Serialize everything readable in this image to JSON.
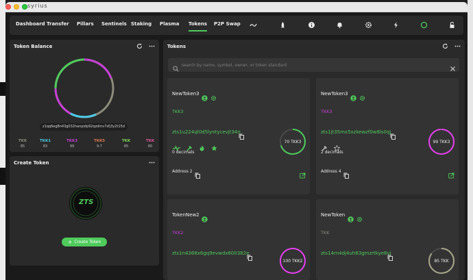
{
  "window": {
    "title": "syrius"
  },
  "nav": {
    "items": [
      {
        "label": "Dashboard"
      },
      {
        "label": "Transfer"
      },
      {
        "label": "Pillars"
      },
      {
        "label": "Sentinels"
      },
      {
        "label": "Staking"
      },
      {
        "label": "Plasma"
      },
      {
        "label": "Tokens",
        "active": true
      },
      {
        "label": "P2P Swap"
      }
    ],
    "icons": [
      "bridge-icon",
      "rocket-icon",
      "info-icon",
      "bell-icon",
      "settings-icon",
      "bolt-icon",
      "status-circle-icon",
      "lock-icon"
    ]
  },
  "token_balance": {
    "title": "Token Balance",
    "address": "z1qq6eg8n43g032hanpsfp92qzdmv7zfj3y2t15d",
    "tokens": [
      {
        "symbol": "TKK",
        "value": "85",
        "color": "#8c8c7c"
      },
      {
        "symbol": "TKK1",
        "value": "83",
        "color": "#4cc9e8"
      },
      {
        "symbol": "TKK3",
        "value": "99",
        "color": "#c63fd6"
      },
      {
        "symbol": "TKK5",
        "value": "9.7",
        "color": "#e07a4f"
      },
      {
        "symbol": "TKK",
        "value": "85",
        "color": "#7ed957"
      },
      {
        "symbol": "TKK",
        "value": "80",
        "color": "#e0529c"
      }
    ],
    "ring_colors": [
      "#4fcb5c",
      "#c63fd6",
      "#4cc9e8",
      "#8c8c7c"
    ]
  },
  "create_token": {
    "title": "Create Token",
    "logo_text": "ZTS",
    "button_label": "Create Token"
  },
  "tokens_panel": {
    "title": "Tokens",
    "search_placeholder": "search by name, symbol, owner, or token standard",
    "cards": [
      {
        "name": "NewToken3",
        "symbol": "TKK3",
        "symbol_color": "#4fcb5c",
        "address": "zts1u224ql0d5lyntycevjt34n",
        "decimals": "0 decimals",
        "address_label": "Address 2",
        "ring_value": "70 TKK3",
        "ring_color": "#4fcb5c",
        "ring_fraction": 0.7
      },
      {
        "name": "NewToken3",
        "symbol": "TKK3",
        "symbol_color": "#c63fd6",
        "address": "zts1jt35mx5xzkewzf0w8ls0qj",
        "decimals": "2 decimals",
        "address_label": "Address 4",
        "ring_value": "99 TKK3",
        "ring_color": "#e63ff0",
        "ring_fraction": 0.99
      },
      {
        "name": "TokenNew2",
        "symbol": "TKK2",
        "symbol_color": "#c63fd6",
        "address": "zts1n4368x6gq9evwdx600382e",
        "ring_value": "100 TKK2",
        "ring_color": "#e63ff0",
        "ring_fraction": 1.0
      },
      {
        "name": "NewToken",
        "symbol": "TKK",
        "symbol_color": "#8c8c7c",
        "address": "zts14rn4dj4uh83gmzrtkye8vj",
        "ring_value": "85 TKK",
        "ring_color": "#a8a88e",
        "ring_fraction": 0.85
      }
    ]
  },
  "colors": {
    "accent": "#4fcb5c",
    "panel": "#2a2a2a",
    "card": "#333333"
  }
}
